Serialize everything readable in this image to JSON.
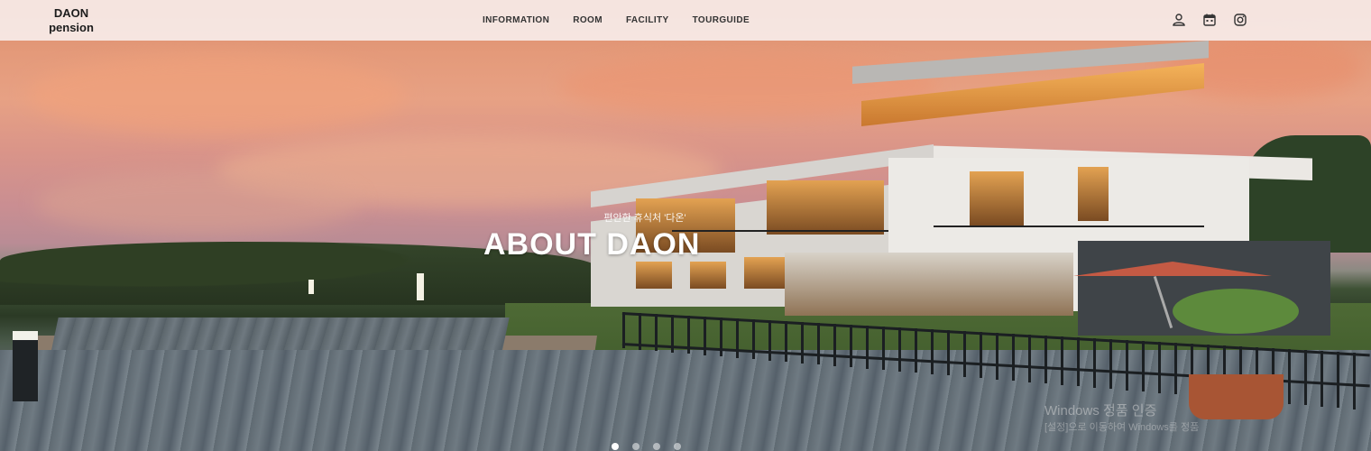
{
  "brand": {
    "line1": "DAON",
    "line2": "pension"
  },
  "nav": {
    "items": [
      "INFORMATION",
      "ROOM",
      "FACILITY",
      "TOURGUIDE"
    ]
  },
  "icons": [
    "user-icon",
    "calendar-icon",
    "instagram-icon"
  ],
  "hero": {
    "subtitle": "편안한 휴식처 '다온'",
    "title": "ABOUT DAON",
    "slides": 4,
    "active_slide": 1
  },
  "watermark": {
    "line1": "Windows 정품 인증",
    "line2": "[설정]으로 이동하여 Windows를 정품"
  },
  "colors": {
    "nav_bg": "#f6eae7",
    "accent": "#ffffff"
  }
}
